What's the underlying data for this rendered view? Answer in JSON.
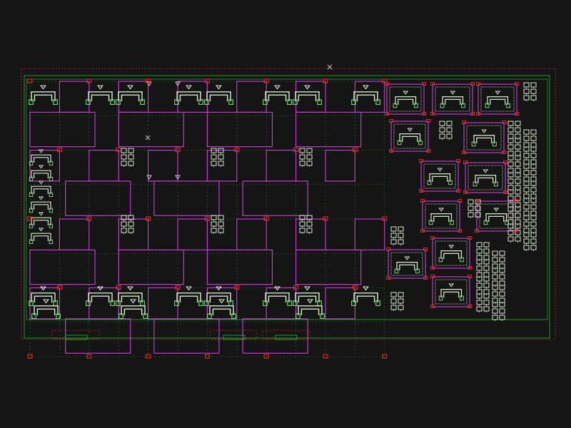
{
  "colors": {
    "background": "#151515",
    "frame_green": "#1e9a2a",
    "guide_green": "#1e7a24",
    "dotted_red": "#b0302a",
    "trace_magenta": "#c03cc8",
    "component_white": "#d8e8d0",
    "component_green": "#7adf7a",
    "via_red": "#e0241c",
    "marker_gray": "#c8c8c8"
  },
  "icons": {
    "cross_marker": "cross-marker-icon",
    "triangle_marker": "triangle-marker-icon",
    "amplifier": "amplifier-symbol-icon",
    "cell_pair": "cell-pair-symbol-icon"
  },
  "grid": {
    "columns": 12,
    "rows": 4
  }
}
